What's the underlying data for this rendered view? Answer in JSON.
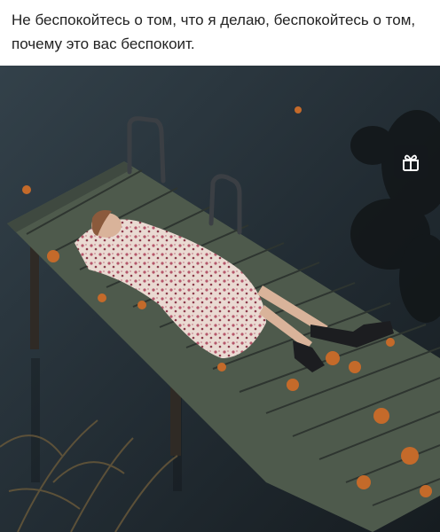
{
  "post": {
    "caption": "Не беспокойтесь о том, что я делаю, беспокойтесь о том, почему это вас беспокоит."
  },
  "photo": {
    "water_color": "#26323a",
    "pier_color": "#4e5a4c",
    "dress_color": "#e9d5cc",
    "leaf_color": "#c46a2a"
  },
  "overlay": {
    "icon": "gift-icon"
  }
}
